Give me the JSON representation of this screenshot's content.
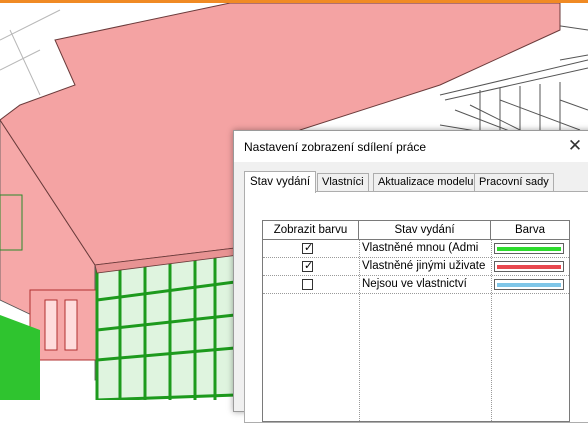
{
  "dialog": {
    "title": "Nastavení zobrazení sdílení práce",
    "close_glyph": "✕",
    "tabs": [
      {
        "label": "Stav vydání",
        "active": true
      },
      {
        "label": "Vlastníci",
        "active": false
      },
      {
        "label": "Aktualizace modelu",
        "active": false
      },
      {
        "label": "Pracovní sady",
        "active": false
      }
    ],
    "table": {
      "headers": [
        "Zobrazit barvu",
        "Stav vydání",
        "Barva"
      ],
      "rows": [
        {
          "checked": true,
          "label": "Vlastněné mnou (Admi",
          "color": "#2ddc2d"
        },
        {
          "checked": true,
          "label": "Vlastněné jinými uživate",
          "color": "#e8474e"
        },
        {
          "checked": false,
          "label": "Nejsou ve vlastnictví",
          "color": "#7fc6e8"
        }
      ]
    }
  },
  "colors": {
    "accent_bar": "#f08a24",
    "roof": "#f4a3a3",
    "glass": "#2fc42f",
    "dialog_bg": "#f0f0f0"
  }
}
